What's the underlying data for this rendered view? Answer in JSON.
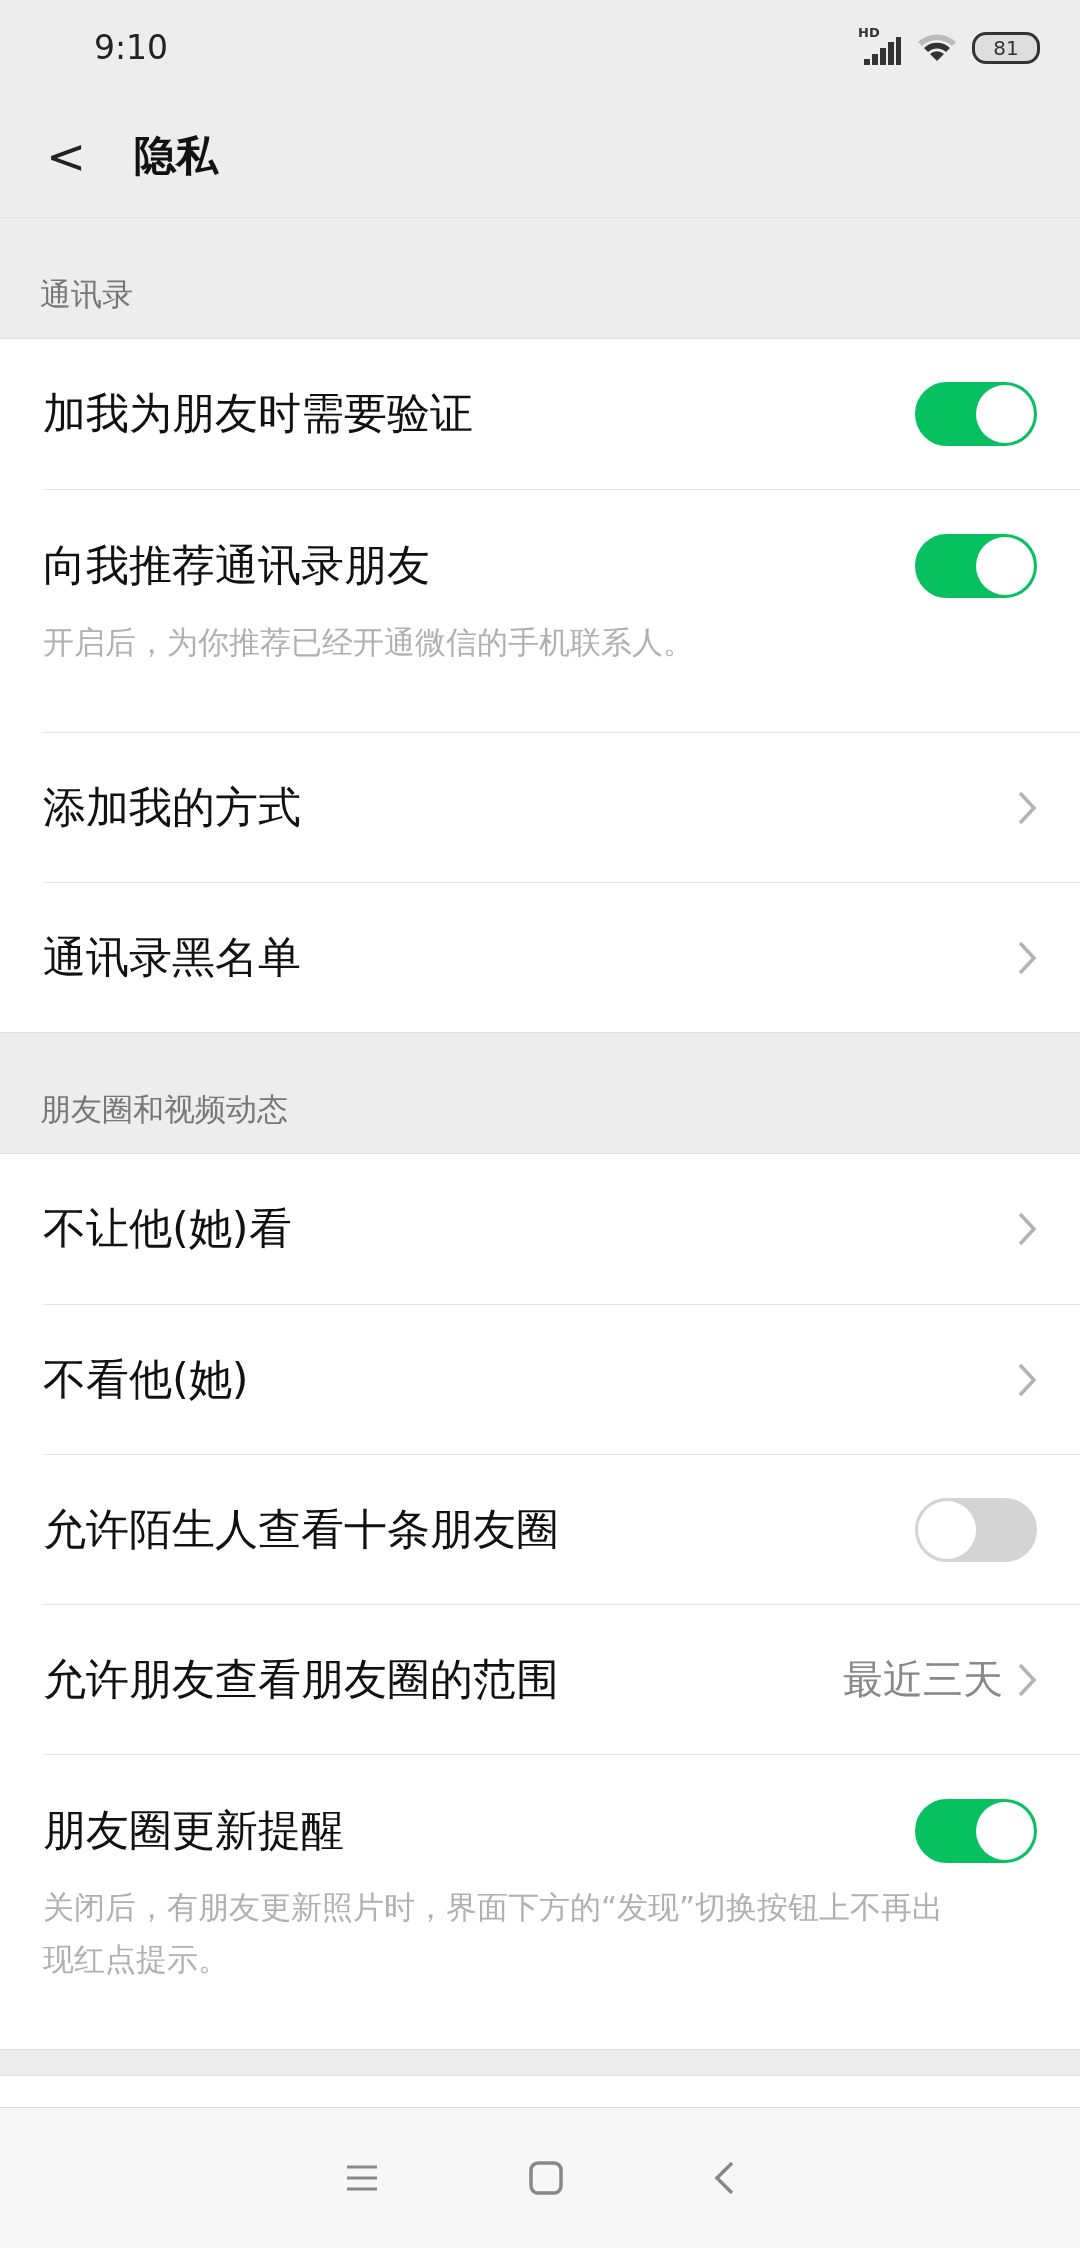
{
  "status_bar": {
    "time": "9:10",
    "network": "HD",
    "battery": "81"
  },
  "header": {
    "back": "<",
    "title": "隐私"
  },
  "sections": [
    {
      "title": "通讯录",
      "items": [
        {
          "kind": "toggle",
          "label": "加我为朋友时需要验证",
          "on": true
        },
        {
          "kind": "toggle",
          "label": "向我推荐通讯录朋友",
          "on": true,
          "description": "开启后，为你推荐已经开通微信的手机联系人。"
        },
        {
          "kind": "link",
          "label": "添加我的方式"
        },
        {
          "kind": "link",
          "label": "通讯录黑名单"
        }
      ]
    },
    {
      "title": "朋友圈和视频动态",
      "items": [
        {
          "kind": "link",
          "label": "不让他(她)看"
        },
        {
          "kind": "link",
          "label": "不看他(她)"
        },
        {
          "kind": "toggle",
          "label": "允许陌生人查看十条朋友圈",
          "on": false
        },
        {
          "kind": "link",
          "label": "允许朋友查看朋友圈的范围",
          "value": "最近三天"
        },
        {
          "kind": "toggle",
          "label": "朋友圈更新提醒",
          "on": true,
          "description": "关闭后，有朋友更新照片时，界面下方的“发现”切换按钮上不再出现红点提示。"
        }
      ]
    }
  ]
}
